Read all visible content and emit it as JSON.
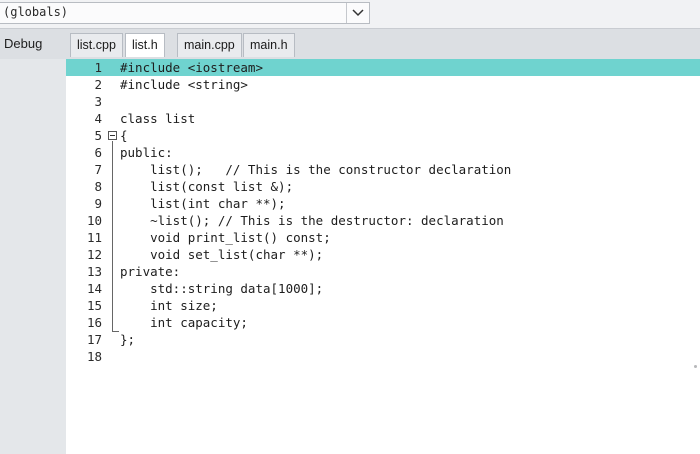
{
  "scope": {
    "label": "(globals)"
  },
  "toolbar": {
    "config": "Debug"
  },
  "tabs": [
    {
      "label": "list.cpp",
      "active": false
    },
    {
      "label": "list.h",
      "active": true
    },
    {
      "label": "main.cpp",
      "active": false
    },
    {
      "label": "main.h",
      "active": false
    }
  ],
  "editor": {
    "lines": [
      {
        "num": "1",
        "text": "#include <iostream>"
      },
      {
        "num": "2",
        "text": "#include <string>"
      },
      {
        "num": "3",
        "text": ""
      },
      {
        "num": "4",
        "text": "class list"
      },
      {
        "num": "5",
        "text": "{"
      },
      {
        "num": "6",
        "text": "public:"
      },
      {
        "num": "7",
        "text": "    list();   // This is the constructor declaration"
      },
      {
        "num": "8",
        "text": "    list(const list &);"
      },
      {
        "num": "9",
        "text": "    list(int char **);"
      },
      {
        "num": "10",
        "text": "    ~list(); // This is the destructor: declaration"
      },
      {
        "num": "11",
        "text": "    void print_list() const;"
      },
      {
        "num": "12",
        "text": "    void set_list(char **);"
      },
      {
        "num": "13",
        "text": "private:"
      },
      {
        "num": "14",
        "text": "    std::string data[1000];"
      },
      {
        "num": "15",
        "text": "    int size;"
      },
      {
        "num": "16",
        "text": "    int capacity;"
      },
      {
        "num": "17",
        "text": "};"
      },
      {
        "num": "18",
        "text": ""
      }
    ]
  },
  "colors": {
    "current_line_highlight": "#6fd3cf",
    "background": "#ffffff",
    "comment": "#2d6a8f"
  }
}
